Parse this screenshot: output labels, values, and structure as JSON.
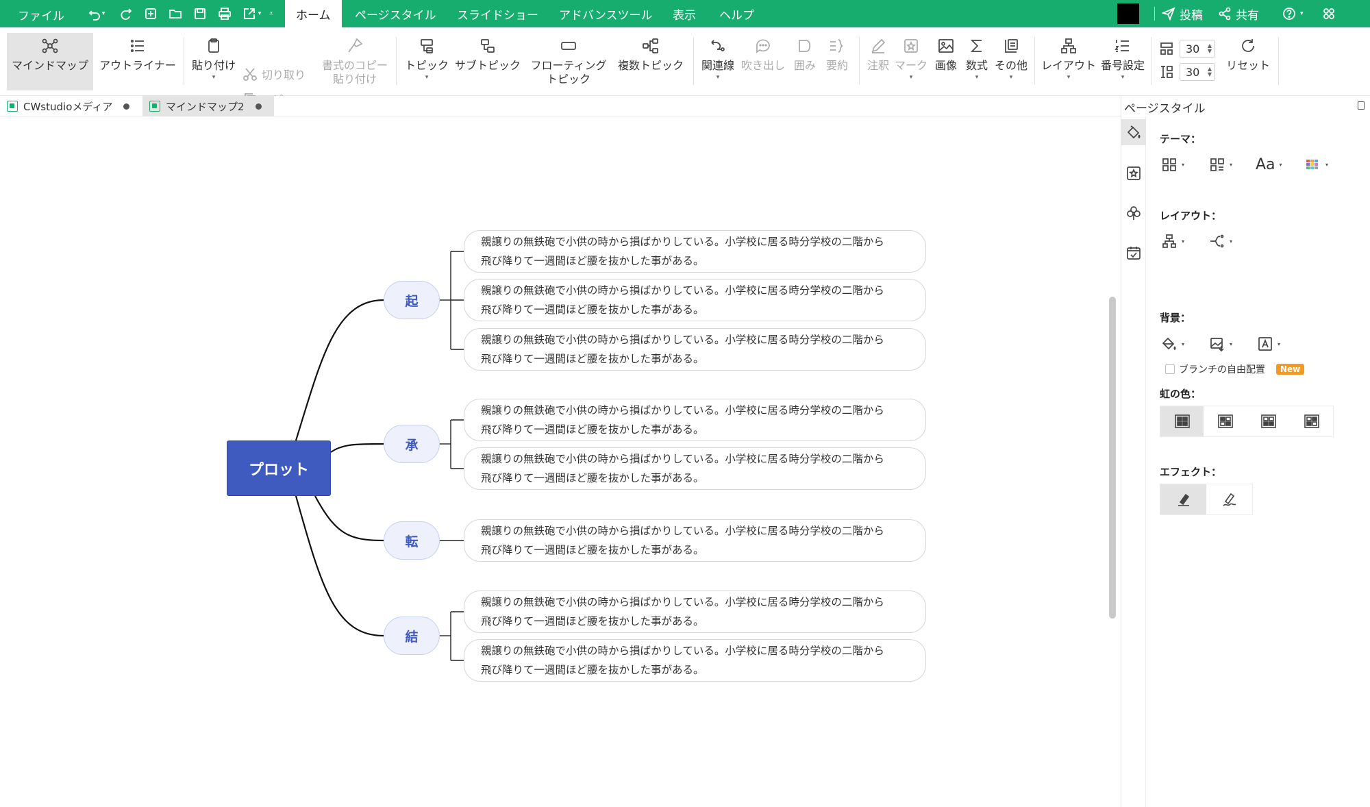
{
  "menubar": {
    "file": "ファイル",
    "tabs": [
      {
        "label": "ホーム",
        "active": true
      },
      {
        "label": "ページスタイル",
        "active": false
      },
      {
        "label": "スライドショー",
        "active": false
      },
      {
        "label": "アドバンスツール",
        "active": false
      },
      {
        "label": "表示",
        "active": false
      },
      {
        "label": "ヘルプ",
        "active": false
      }
    ],
    "post": "投稿",
    "share": "共有",
    "accent": "#16ad6e"
  },
  "ribbon": {
    "mindmap": "マインドマップ",
    "outliner": "アウトライナー",
    "paste": "貼り付け",
    "cut": "切り取り",
    "copy": "コピー",
    "format_copy_1": "書式のコピー",
    "format_copy_2": "貼り付け",
    "topic": "トピック",
    "subtopic": "サブトピック",
    "floating_1": "フローティング",
    "floating_2": "トピック",
    "multi_topic": "複数トピック",
    "relation": "関連線",
    "callout": "吹き出し",
    "boundary": "囲み",
    "summary": "要約",
    "note": "注釈",
    "mark": "マーク",
    "image": "画像",
    "formula": "数式",
    "other": "その他",
    "layout": "レイアウト",
    "numbering": "番号設定",
    "spacing_h": "30",
    "spacing_v": "30",
    "reset": "リセット"
  },
  "doctabs": [
    {
      "label": "CWstudioメディア",
      "active": false
    },
    {
      "label": "マインドマップ2",
      "active": true
    }
  ],
  "mindmap": {
    "root": "プロット",
    "root_color": "#3f5bbf",
    "branches": [
      {
        "label": "起",
        "leaves": [
          {
            "line1": "親譲りの無鉄砲で小供の時から損ばかりしている。小学校に居る時分学校の二階から",
            "line2": "飛び降りて一週間ほど腰を抜かした事がある。"
          },
          {
            "line1": "親譲りの無鉄砲で小供の時から損ばかりしている。小学校に居る時分学校の二階から",
            "line2": "飛び降りて一週間ほど腰を抜かした事がある。"
          },
          {
            "line1": "親譲りの無鉄砲で小供の時から損ばかりしている。小学校に居る時分学校の二階から",
            "line2": "飛び降りて一週間ほど腰を抜かした事がある。"
          }
        ]
      },
      {
        "label": "承",
        "leaves": [
          {
            "line1": "親譲りの無鉄砲で小供の時から損ばかりしている。小学校に居る時分学校の二階から",
            "line2": "飛び降りて一週間ほど腰を抜かした事がある。"
          },
          {
            "line1": "親譲りの無鉄砲で小供の時から損ばかりしている。小学校に居る時分学校の二階から",
            "line2": "飛び降りて一週間ほど腰を抜かした事がある。"
          }
        ]
      },
      {
        "label": "転",
        "leaves": [
          {
            "line1": "親譲りの無鉄砲で小供の時から損ばかりしている。小学校に居る時分学校の二階から",
            "line2": "飛び降りて一週間ほど腰を抜かした事がある。"
          }
        ]
      },
      {
        "label": "結",
        "leaves": [
          {
            "line1": "親譲りの無鉄砲で小供の時から損ばかりしている。小学校に居る時分学校の二階から",
            "line2": "飛び降りて一週間ほど腰を抜かした事がある。"
          },
          {
            "line1": "親譲りの無鉄砲で小供の時から損ばかりしている。小学校に居る時分学校の二階から",
            "line2": "飛び降りて一週間ほど腰を抜かした事がある。"
          }
        ]
      }
    ]
  },
  "panel": {
    "title": "ページスタイル",
    "theme": "テーマ：",
    "font_label": "Aa",
    "layout": "レイアウト：",
    "branch_free": "ブランチの自由配置",
    "new_badge": "New",
    "background": "背景：",
    "rainbow": "虹の色：",
    "effect": "エフェクト："
  }
}
